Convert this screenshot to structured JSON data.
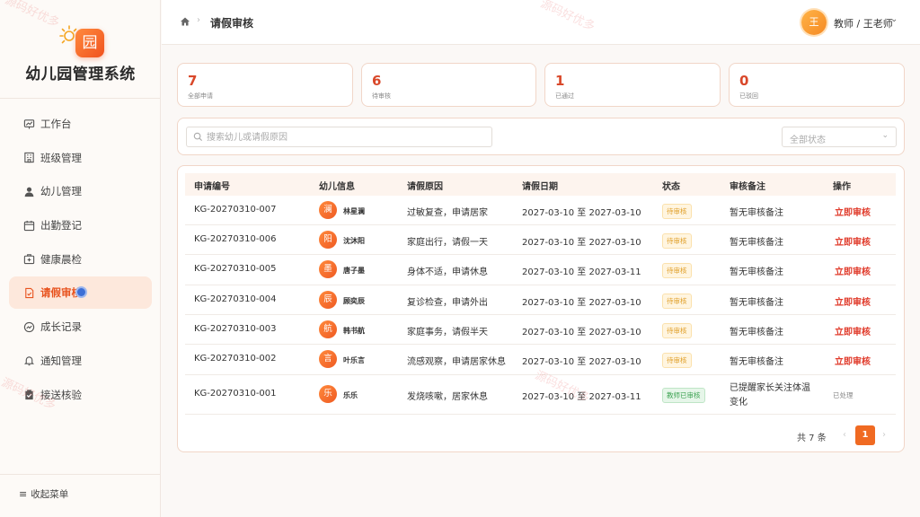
{
  "app": {
    "title": "幼儿园管理系统",
    "logo_glyph": "园"
  },
  "sidebar": {
    "items": [
      {
        "label": "工作台",
        "icon": "dashboard-icon"
      },
      {
        "label": "班级管理",
        "icon": "building-icon"
      },
      {
        "label": "幼儿管理",
        "icon": "person-icon"
      },
      {
        "label": "出勤登记",
        "icon": "calendar-icon"
      },
      {
        "label": "健康晨检",
        "icon": "medical-kit-icon"
      },
      {
        "label": "请假审核",
        "icon": "document-check-icon",
        "active": true
      },
      {
        "label": "成长记录",
        "icon": "growth-chart-icon"
      },
      {
        "label": "通知管理",
        "icon": "bell-icon"
      },
      {
        "label": "接送核验",
        "icon": "clipboard-check-icon"
      }
    ],
    "collapse_label": "收起菜单"
  },
  "header": {
    "breadcrumb": "请假审核",
    "user_avatar": "王",
    "user_name": "教师 / 王老师"
  },
  "stats": [
    {
      "value": "7",
      "label": "全部申请"
    },
    {
      "value": "6",
      "label": "待审核"
    },
    {
      "value": "1",
      "label": "已通过"
    },
    {
      "value": "0",
      "label": "已驳回"
    }
  ],
  "filter": {
    "search_placeholder": "搜索幼儿或请假原因",
    "status_value": "全部状态"
  },
  "table": {
    "columns": [
      "申请编号",
      "幼儿信息",
      "请假原因",
      "请假日期",
      "状态",
      "审核备注",
      "操作"
    ],
    "rows": [
      {
        "id": "KG-20270310-007",
        "avatar": "澜",
        "name": "林星澜",
        "reason": "过敏复查，申请居家",
        "date": "2027-03-10 至 2027-03-10",
        "status": "待审核",
        "status_type": "pending",
        "note": "暂无审核备注",
        "action": "立即审核"
      },
      {
        "id": "KG-20270310-006",
        "avatar": "阳",
        "name": "沈沐阳",
        "reason": "家庭出行，请假一天",
        "date": "2027-03-10 至 2027-03-10",
        "status": "待审核",
        "status_type": "pending",
        "note": "暂无审核备注",
        "action": "立即审核"
      },
      {
        "id": "KG-20270310-005",
        "avatar": "墨",
        "name": "唐子墨",
        "reason": "身体不适，申请休息",
        "date": "2027-03-10 至 2027-03-11",
        "status": "待审核",
        "status_type": "pending",
        "note": "暂无审核备注",
        "action": "立即审核"
      },
      {
        "id": "KG-20270310-004",
        "avatar": "辰",
        "name": "顾奕辰",
        "reason": "复诊检查，申请外出",
        "date": "2027-03-10 至 2027-03-10",
        "status": "待审核",
        "status_type": "pending",
        "note": "暂无审核备注",
        "action": "立即审核"
      },
      {
        "id": "KG-20270310-003",
        "avatar": "航",
        "name": "韩书航",
        "reason": "家庭事务，请假半天",
        "date": "2027-03-10 至 2027-03-10",
        "status": "待审核",
        "status_type": "pending",
        "note": "暂无审核备注",
        "action": "立即审核"
      },
      {
        "id": "KG-20270310-002",
        "avatar": "言",
        "name": "叶乐言",
        "reason": "流感观察，申请居家休息",
        "date": "2027-03-10 至 2027-03-10",
        "status": "待审核",
        "status_type": "pending",
        "note": "暂无审核备注",
        "action": "立即审核"
      },
      {
        "id": "KG-20270310-001",
        "avatar": "乐",
        "name": "乐乐",
        "reason": "发烧咳嗽，居家休息",
        "date": "2027-03-10 至 2027-03-11",
        "status": "教师已审核",
        "status_type": "done",
        "note": "已提醒家长关注体温变化",
        "action": "已处理"
      }
    ]
  },
  "pager": {
    "total": "共 7 条",
    "current_page": "1"
  },
  "watermark": "源码好优多",
  "colors": {
    "accent": "#f06a22",
    "danger": "#e03a2a",
    "pending": "#e0a02b",
    "success": "#3ea353"
  }
}
